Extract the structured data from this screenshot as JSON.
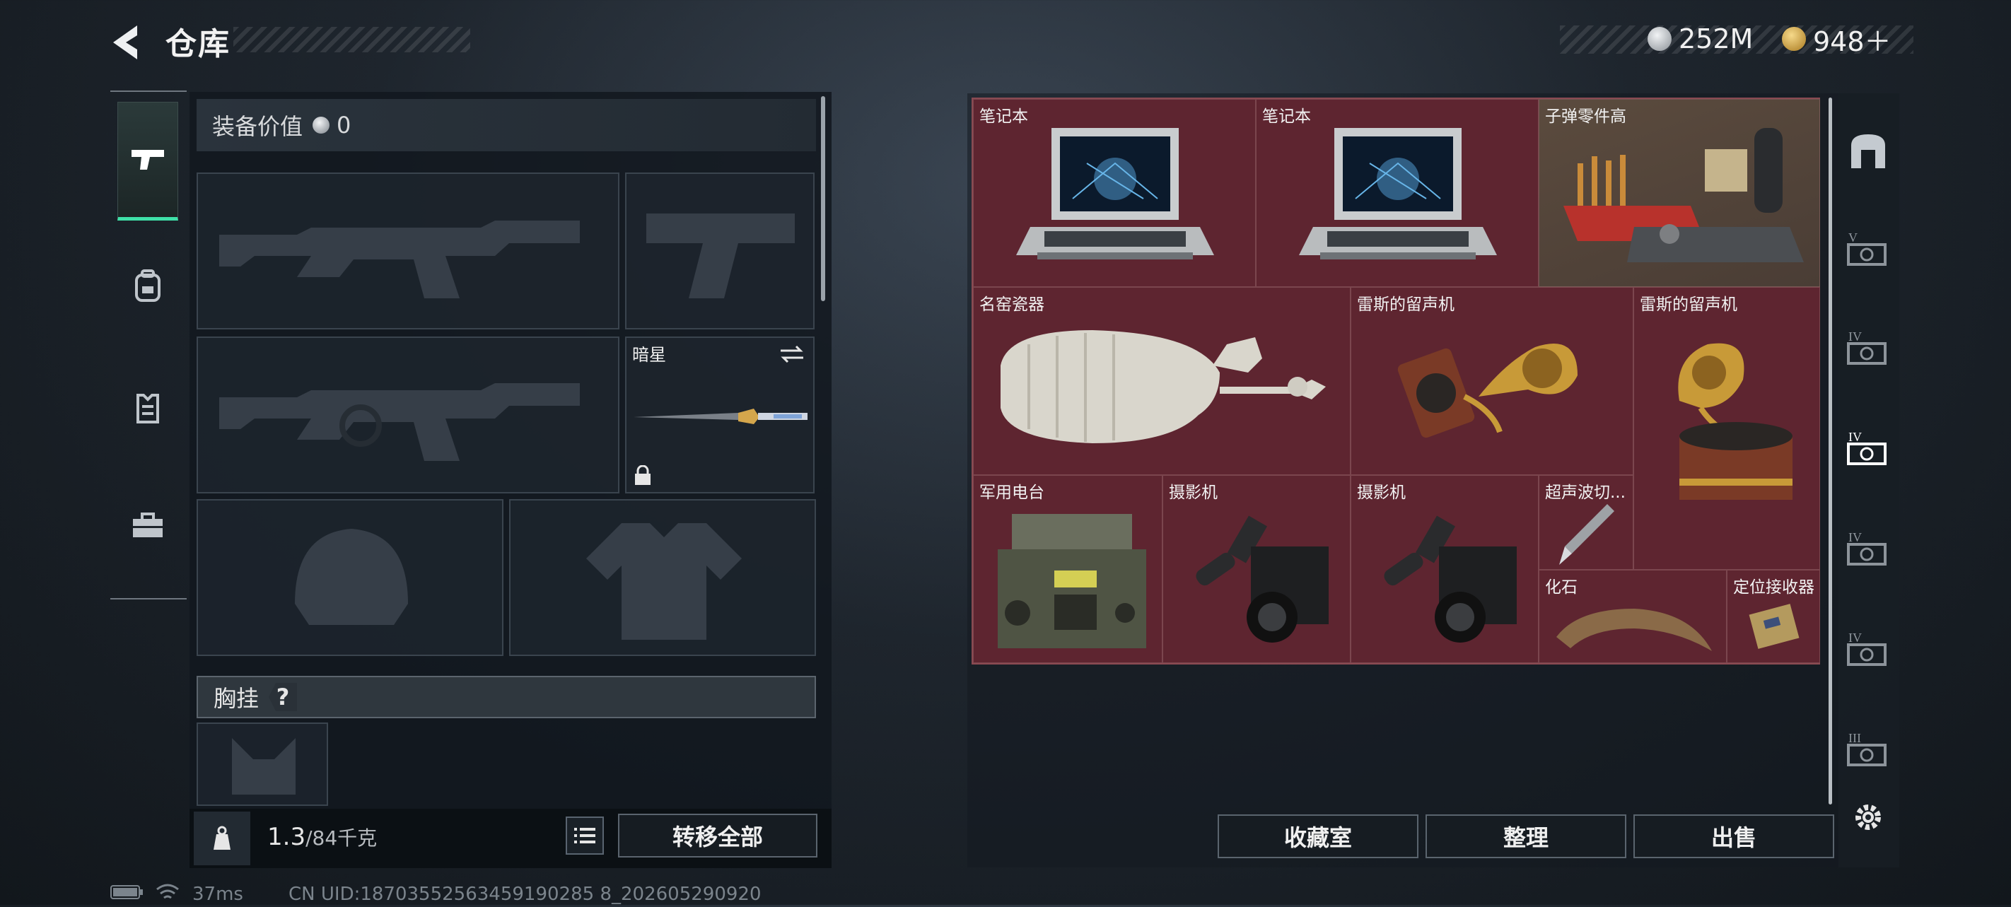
{
  "header": {
    "title": "仓库"
  },
  "currencies": [
    {
      "name": "coin-silver",
      "amount": "252M",
      "color": "#c8ccd0"
    },
    {
      "name": "coin-gold",
      "amount": "948＋",
      "color": "#d7a744"
    }
  ],
  "sidebar": {
    "items": [
      {
        "icon": "pistol-icon",
        "active": true
      },
      {
        "icon": "backpack-icon",
        "active": false
      },
      {
        "icon": "vest-icon",
        "active": false
      },
      {
        "icon": "toolbox-icon",
        "active": false
      }
    ]
  },
  "equipment": {
    "value_label": "装备价值",
    "value": "0",
    "melee_slot": {
      "label": "暗星"
    },
    "chest_rig_label": "胸挂",
    "chest_rig_help": "?",
    "weight_current": "1.3",
    "weight_max": "/84千克",
    "transfer_all": "转移全部"
  },
  "storage": {
    "items": [
      {
        "label": "笔记本",
        "kind": "laptop"
      },
      {
        "label": "笔记本",
        "kind": "laptop"
      },
      {
        "label": "子弹零件高",
        "kind": "ammo-parts"
      },
      {
        "label": "名窑瓷器",
        "kind": "vase"
      },
      {
        "label": "雷斯的留声机",
        "kind": "gramophone"
      },
      {
        "label": "雷斯的留声机",
        "kind": "gramophone"
      },
      {
        "label": "军用电台",
        "kind": "radio"
      },
      {
        "label": "摄影机",
        "kind": "camera"
      },
      {
        "label": "摄影机",
        "kind": "camera"
      },
      {
        "label": "超声波切...",
        "kind": "scalpel"
      },
      {
        "label": "化石",
        "kind": "fossil"
      },
      {
        "label": "定位接收器",
        "kind": "receiver"
      }
    ],
    "actions": {
      "collection": "收藏室",
      "organize": "整理",
      "sell": "出售"
    }
  },
  "rail": {
    "items": [
      {
        "icon": "container-icon",
        "tier": ""
      },
      {
        "icon": "safe-box-icon",
        "tier": "V"
      },
      {
        "icon": "safe-box-icon",
        "tier": "IV"
      },
      {
        "icon": "safe-box-icon",
        "tier": "IV"
      },
      {
        "icon": "safe-box-icon",
        "tier": "IV"
      },
      {
        "icon": "safe-box-icon",
        "tier": "IV"
      },
      {
        "icon": "safe-box-icon",
        "tier": "III"
      }
    ],
    "settings": "gear-icon"
  },
  "status": {
    "ping": "37ms",
    "uid": "CN UID:18703552563459190285 8_202605290920"
  }
}
